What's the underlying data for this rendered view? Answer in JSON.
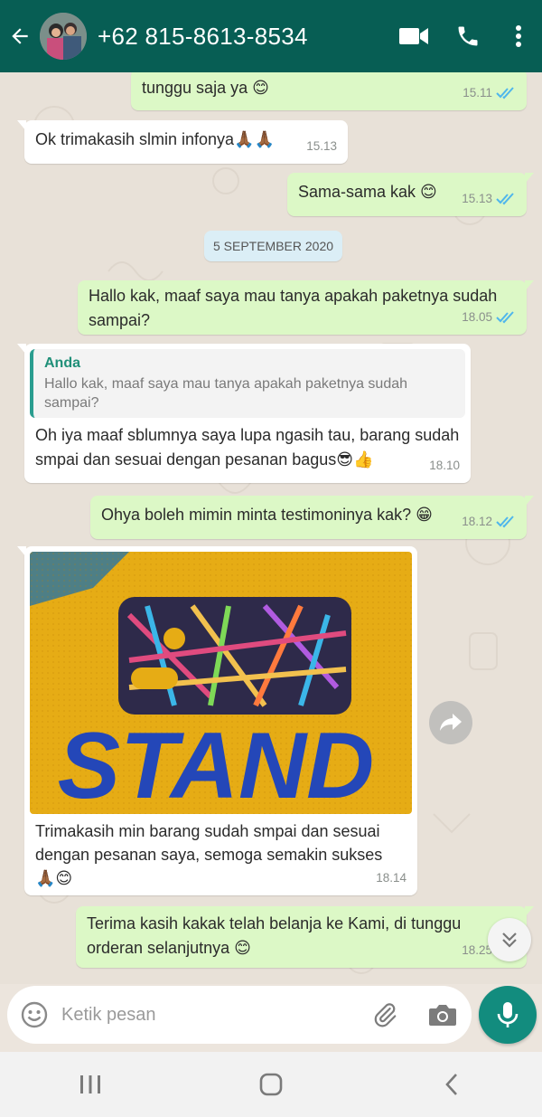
{
  "header": {
    "contact_name": "+62 815-8613-8534",
    "icons": [
      "back-arrow-icon",
      "video-call-icon",
      "phone-icon",
      "more-vert-icon"
    ]
  },
  "messages": [
    {
      "direction": "out",
      "text": "tunggu saja ya 😊",
      "time": "15.11",
      "read": true
    },
    {
      "direction": "in",
      "text": "Ok trimakasih slmin infonya🙏🏾🙏🏾",
      "time": "15.13"
    },
    {
      "direction": "out",
      "text": "Sama-sama kak 😊",
      "time": "15.13",
      "read": true
    },
    {
      "direction": "out",
      "text": "Hallo kak, maaf saya mau tanya apakah paketnya sudah sampai?",
      "time": "18.05",
      "read": true
    },
    {
      "direction": "in",
      "quote_author": "Anda",
      "quote_text": "Hallo kak, maaf saya mau tanya apakah paketnya sudah sampai?",
      "text": "Oh iya maaf sblumnya saya lupa ngasih tau, barang sudah smpai dan sesuai dengan pesanan bagus😎👍",
      "time": "18.10"
    },
    {
      "direction": "out",
      "text": "Ohya boleh mimin minta testimoninya kak? 😁",
      "time": "18.12",
      "read": true
    },
    {
      "direction": "in",
      "has_photo": true,
      "photo_text": "STAND",
      "text": "Trimakasih min barang sudah smpai dan sesuai dengan pesanan saya, semoga semakin sukses 🙏🏾😊",
      "time": "18.14"
    },
    {
      "direction": "out",
      "text": "Terima kasih kakak telah belanja ke Kami, di tunggu orderan selanjutnya 😊",
      "time": "18.25",
      "read": true
    }
  ],
  "date_separator": "5 SEPTEMBER 2020",
  "composer": {
    "placeholder": "Ketik pesan",
    "icons": [
      "emoji-icon",
      "attach-icon",
      "camera-icon",
      "mic-icon"
    ]
  },
  "colors": {
    "header": "#075e54",
    "outgoing_bubble": "#dcf8c6",
    "incoming_bubble": "#ffffff",
    "accent": "#128c7e",
    "read_ticks": "#4fb6ec"
  }
}
